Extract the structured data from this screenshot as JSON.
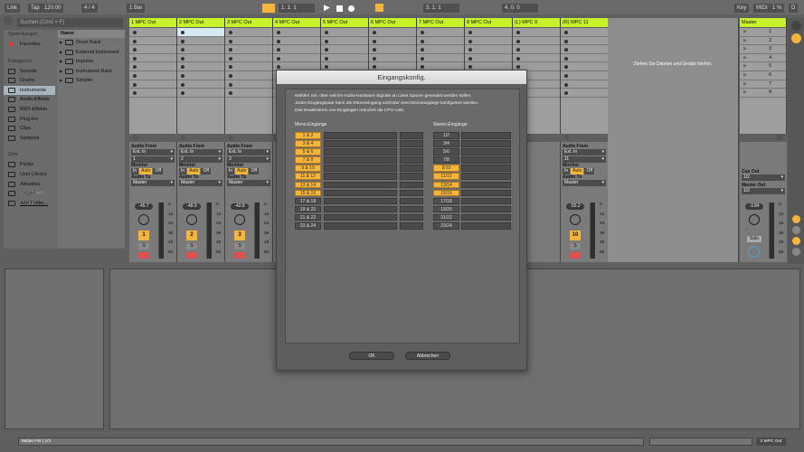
{
  "topbar": {
    "link": "Link",
    "tap": "Tap",
    "tempo": "120.00",
    "signature": "4 / 4",
    "quantize": "1 Bar",
    "position": "1.  1.  1",
    "loop_start": "3.  1.  1",
    "loop_length": "4.  0.  0",
    "key": "Key",
    "midi": "MIDI",
    "cpu": "1 %",
    "disk": "D"
  },
  "browser": {
    "search_placeholder": "Suchen (Cmd + F)",
    "collections_header": "Sammlungen",
    "favorites": "Favorites",
    "categories_header": "Kategorien",
    "categories": [
      "Sounds",
      "Drums",
      "Instrumente",
      "Audio-Effekte",
      "MIDI-Effekte",
      "Plug-Ins",
      "Clips",
      "Samples"
    ],
    "places_header": "Orte",
    "places": [
      "Packs",
      "User Library",
      "Aktuelles Projekt",
      "Mod-Solo1 Projekt",
      "Add Folder..."
    ],
    "name_header": "Name",
    "items": [
      "Drum Rack",
      "External Instrument",
      "Impulse",
      "Instrument Rack",
      "Simpler"
    ]
  },
  "tracks": [
    {
      "name": "1 MPC Out",
      "input": "1",
      "volume": "-45.7",
      "number": "1"
    },
    {
      "name": "2 MPC Out",
      "input": "2",
      "volume": "-48.9",
      "number": "2"
    },
    {
      "name": "3 MPC Out",
      "input": "3",
      "volume": "-42.8",
      "number": "3"
    },
    {
      "name": "4 MPC Out"
    },
    {
      "name": "5 MPC Out"
    },
    {
      "name": "6 MPC Out"
    },
    {
      "name": "7 MPC Out"
    },
    {
      "name": "8 MPC Out"
    },
    {
      "name": "(L) MPC 9"
    },
    {
      "name": "(R) MPC 11",
      "input": "11",
      "volume": "-55.2",
      "number": "10"
    }
  ],
  "io": {
    "audio_from": "Audio From",
    "ext_in": "Ext. In",
    "monitor": "Monitor",
    "in": "In",
    "auto": "Auto",
    "off": "Off",
    "audio_to": "Audio To",
    "master": "Master",
    "solo": "S"
  },
  "meter_scale": [
    "0",
    "12",
    "24",
    "36",
    "48",
    "60"
  ],
  "drop_hint": "Ziehen Sie Dateien und Geräte hierhin.",
  "master": {
    "name": "Master",
    "scenes": [
      "1",
      "2",
      "3",
      "4",
      "5",
      "6",
      "7",
      "8"
    ],
    "cue_out_label": "Cue Out",
    "cue_out": "1/2",
    "master_out_label": "Master Out",
    "master_out": "1/2",
    "volume": "-3.84",
    "solo": "Solo"
  },
  "dialog": {
    "title": "Eingangskonfig.",
    "text": [
      "Wählen Sie, über welche Audio-Hardware Signale an Lives Spuren gesendet werden sollen.",
      "Jedes Eingangspaar kann als Stereoeingang und/oder zwei Monoeingänge konfiguriert werden.",
      "Das Deaktivieren von Eingängen reduziert die CPU-Last."
    ],
    "mono_header": "Mono-Eingänge",
    "stereo_header": "Stereo-Eingänge",
    "mono": [
      {
        "label": "1 & 2",
        "on": true
      },
      {
        "label": "3 & 4",
        "on": true
      },
      {
        "label": "5 & 6",
        "on": true
      },
      {
        "label": "7 & 8",
        "on": true
      },
      {
        "label": "9 & 10",
        "on": true
      },
      {
        "label": "11 & 12",
        "on": true
      },
      {
        "label": "13 & 14",
        "on": true
      },
      {
        "label": "15 & 16",
        "on": true
      },
      {
        "label": "17 & 18",
        "on": false
      },
      {
        "label": "19 & 20",
        "on": false
      },
      {
        "label": "21 & 22",
        "on": false
      },
      {
        "label": "23 & 24",
        "on": false
      }
    ],
    "stereo": [
      {
        "label": "1/2",
        "on": false
      },
      {
        "label": "3/4",
        "on": false
      },
      {
        "label": "5/6",
        "on": false
      },
      {
        "label": "7/8",
        "on": false
      },
      {
        "label": "9/10",
        "on": true
      },
      {
        "label": "11/12",
        "on": true
      },
      {
        "label": "13/14",
        "on": true
      },
      {
        "label": "15/16",
        "on": true
      },
      {
        "label": "17/18",
        "on": false
      },
      {
        "label": "19/20",
        "on": false
      },
      {
        "label": "21/22",
        "on": false
      },
      {
        "label": "23/24",
        "on": false
      }
    ],
    "ok": "OK",
    "cancel": "Abbrechen"
  },
  "status": {
    "device": "Midas FW | 1/2",
    "selected_track": "2 MPC Out"
  },
  "colors": {
    "track": "#c8f12a",
    "active": "#f5b43a",
    "arm": "#e05050"
  }
}
